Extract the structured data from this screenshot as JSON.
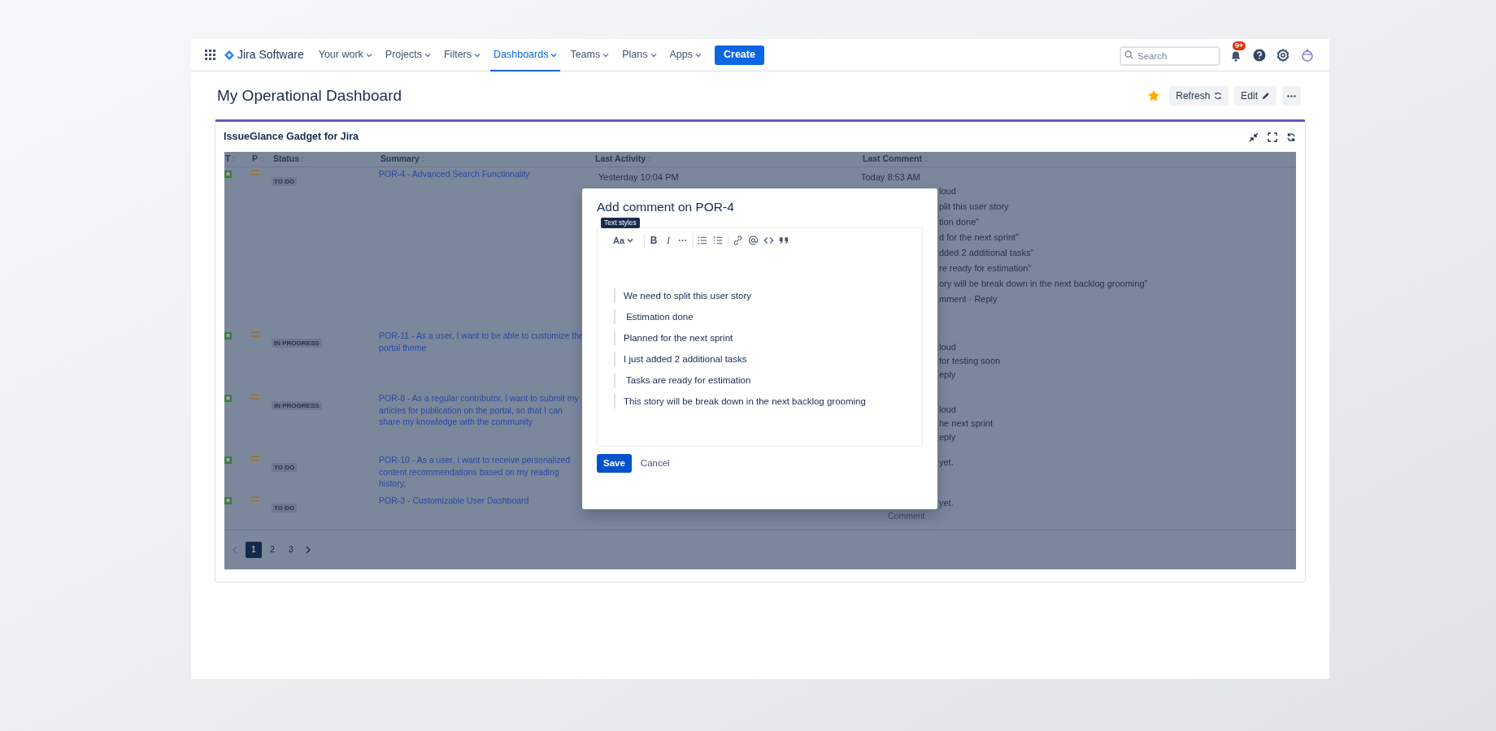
{
  "nav": {
    "product": "Jira Software",
    "items": [
      {
        "label": "Your work",
        "selected": false
      },
      {
        "label": "Projects",
        "selected": false
      },
      {
        "label": "Filters",
        "selected": false
      },
      {
        "label": "Dashboards",
        "selected": true
      },
      {
        "label": "Teams",
        "selected": false
      },
      {
        "label": "Plans",
        "selected": false
      },
      {
        "label": "Apps",
        "selected": false
      }
    ],
    "create": "Create",
    "search": {
      "placeholder": "Search"
    },
    "notifications_badge": "9+"
  },
  "dashboard": {
    "title": "My Operational Dashboard",
    "starred": true,
    "buttons": [
      {
        "kind": "refresh",
        "label": "Refresh"
      },
      {
        "kind": "edit",
        "label": "Edit"
      }
    ]
  },
  "gadget": {
    "title": "IssueGlance Gadget for Jira",
    "table": {
      "columns": [
        "T",
        "P",
        "Status",
        "Summary",
        "Last Activity",
        "Last Comment"
      ],
      "rows": [
        {
          "status": "TO DO",
          "summary": "POR-4 - Advanced Search Functionality",
          "last_activity": "Yesterday 10:04 PM",
          "comment_date": "Today 8:53 AM",
          "comment_lines": [
            {
              "kind": "fragment",
              "text": "loud"
            },
            {
              "kind": "fragment",
              "text": "plit this user story"
            },
            {
              "kind": "fragment",
              "text": "tion done”"
            },
            {
              "kind": "fragment",
              "text": "d for the next sprint”"
            },
            {
              "kind": "fragment",
              "text": "dded 2 additional tasks”"
            },
            {
              "kind": "fragment",
              "text": "re ready for estimation”"
            },
            {
              "kind": "fragment",
              "text": "ory will be break down in the next backlog grooming”"
            },
            {
              "kind": "fragment",
              "text": "mment · Reply"
            }
          ]
        },
        {
          "status": "IN PROGRESS",
          "summary": "POR-11 - As a user, I want to be able to customize the portal theme",
          "comment_lines": [
            {
              "kind": "fragment",
              "text": "loud"
            },
            {
              "kind": "fragment",
              "text": "for testing soon"
            },
            {
              "kind": "fragment",
              "text": "eply"
            }
          ]
        },
        {
          "status": "IN PROGRESS",
          "summary": "POR-8 - As a regular contributor, I want to submit my articles for publication on the portal, so that I can share my knowledge with the community",
          "comment_lines": [
            {
              "kind": "fragment",
              "text": "loud"
            },
            {
              "kind": "fragment",
              "text": "he next sprint"
            },
            {
              "kind": "fragment",
              "text": "eply"
            }
          ]
        },
        {
          "status": "TO DO",
          "summary": "POR-10 - As a user, I want to receive personalized content recommendations based on my reading history,",
          "comment_lines": [
            {
              "kind": "fragment",
              "text": "yet."
            }
          ]
        },
        {
          "status": "TO DO",
          "summary": "POR-3 - Customizable User Dashboard",
          "comment_lines": [
            {
              "kind": "fragment",
              "text": "yet."
            },
            {
              "kind": "action",
              "text": "Comment"
            }
          ]
        }
      ]
    },
    "pagination": {
      "prev_disabled": true,
      "pages": [
        {
          "label": "1",
          "selected": true
        },
        {
          "label": "2",
          "selected": false
        },
        {
          "label": "3",
          "selected": false
        }
      ]
    }
  },
  "dialog": {
    "title": "Add comment on POR-4",
    "tooltip": "Text styles",
    "toolbar": [
      [
        {
          "kind": "styles",
          "label": "Aa"
        }
      ],
      [
        {
          "kind": "bold",
          "label": "B"
        },
        {
          "kind": "italic",
          "label": "I"
        },
        {
          "kind": "more"
        }
      ],
      [
        {
          "kind": "bullets"
        },
        {
          "kind": "numbers"
        }
      ],
      [
        {
          "kind": "link"
        },
        {
          "kind": "mention"
        },
        {
          "kind": "code"
        },
        {
          "kind": "quote"
        }
      ]
    ],
    "quotes": [
      "We need to split this user story",
      " Estimation done",
      "Planned for the next sprint",
      "I just added 2 additional tasks",
      " Tasks are ready for estimation",
      "This story will be break down in the next backlog grooming"
    ],
    "save": "Save",
    "cancel": "Cancel"
  }
}
